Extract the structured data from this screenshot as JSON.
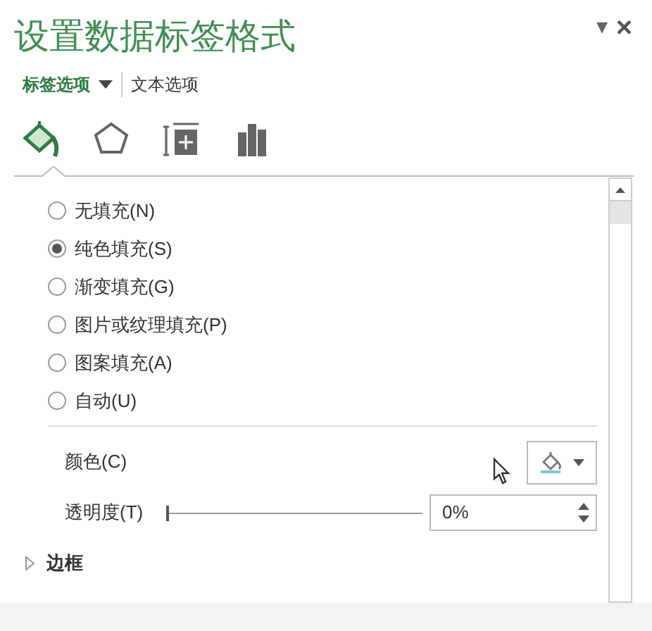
{
  "pane": {
    "title": "设置数据标签格式",
    "menu_glyph": "▾",
    "close_glyph": "×"
  },
  "tabs": [
    {
      "label": "标签选项",
      "selected": true,
      "dropdown": true
    },
    {
      "label": "文本选项",
      "selected": false,
      "dropdown": false
    }
  ],
  "category_icons": [
    {
      "kind": "fill",
      "selected": true
    },
    {
      "kind": "pentagon",
      "selected": false
    },
    {
      "kind": "size",
      "selected": false
    },
    {
      "kind": "bars",
      "selected": false
    }
  ],
  "fill_options": [
    {
      "label": "无填充(N)",
      "selected": false
    },
    {
      "label": "纯色填充(S)",
      "selected": true
    },
    {
      "label": "渐变填充(G)",
      "selected": false
    },
    {
      "label": "图片或纹理填充(P)",
      "selected": false
    },
    {
      "label": "图案填充(A)",
      "selected": false
    },
    {
      "label": "自动(U)",
      "selected": false
    }
  ],
  "color": {
    "label": "颜色(C)"
  },
  "transparency": {
    "label": "透明度(T)",
    "level": 0,
    "value": "0%"
  },
  "sections": [
    {
      "label": "边框",
      "expanded": false
    }
  ]
}
